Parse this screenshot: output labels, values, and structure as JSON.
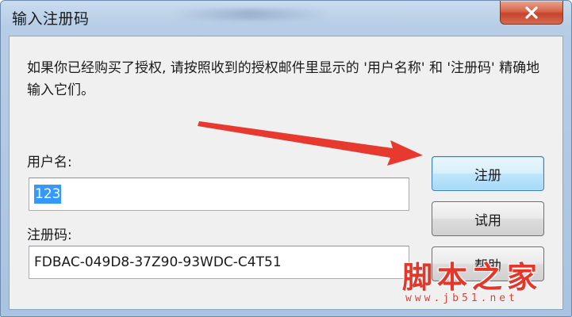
{
  "window": {
    "title": "输入注册码",
    "close_icon": "close-icon"
  },
  "message": "如果你已经购买了授权, 请按照收到的授权邮件里显示的 '用户名称' 和 '注册码' 精确地输入它们。",
  "fields": {
    "username_label": "用户名:",
    "username_value": "123",
    "regcode_label": "注册码:",
    "regcode_value": "FDBAC-049D8-37Z90-93WDC-C4T51"
  },
  "buttons": {
    "register": "注册",
    "trial": "试用",
    "help": "帮助"
  },
  "watermark": {
    "text": "脚本之家",
    "url": "www.jb51.net"
  },
  "colors": {
    "arrow": "#e8392e",
    "selection": "#3399ff",
    "watermark": "#e3372b"
  }
}
